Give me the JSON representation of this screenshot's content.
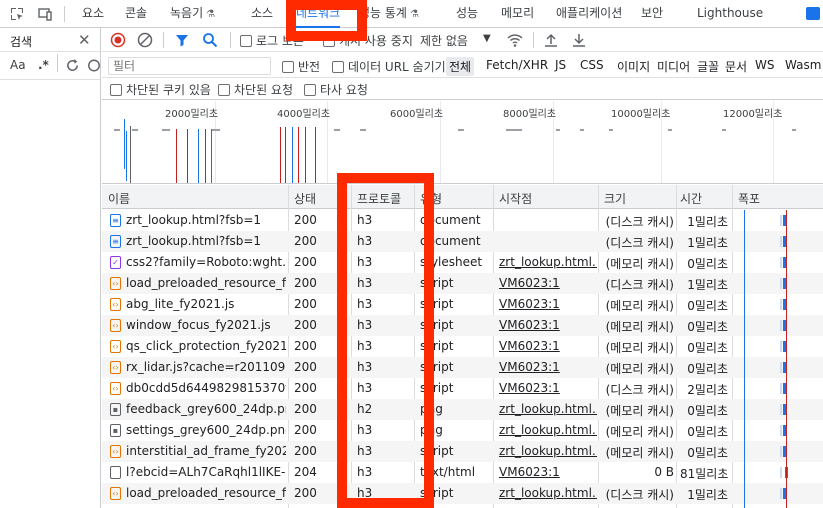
{
  "top_tabs": [
    {
      "label": "요소",
      "active": false,
      "flask": false
    },
    {
      "label": "콘솔",
      "active": false,
      "flask": false
    },
    {
      "label": "녹음기",
      "active": false,
      "flask": true
    },
    {
      "label": "소스",
      "active": false,
      "flask": false
    },
    {
      "label": "네트워크",
      "active": true,
      "flask": false
    },
    {
      "label": "성능 통계",
      "active": false,
      "flask": true
    },
    {
      "label": "성능",
      "active": false,
      "flask": false
    },
    {
      "label": "메모리",
      "active": false,
      "flask": false
    },
    {
      "label": "애플리케이션",
      "active": false,
      "flask": false
    },
    {
      "label": "보안",
      "active": false,
      "flask": false
    },
    {
      "label": "Lighthouse",
      "active": false,
      "flask": false
    }
  ],
  "sidebar": {
    "title": "검색",
    "close_icon": "close-icon",
    "match_case": "Aa",
    "regex": ".*"
  },
  "toolbar": {
    "preserve_log": "로그 보존",
    "disable_cache": "캐시 사용 중지",
    "throttle": "제한 없음"
  },
  "filter": {
    "placeholder": "필터",
    "invert": "반전",
    "hide_data_urls": "데이터 URL 숨기기",
    "types": [
      "전체",
      "Fetch/XHR",
      "JS",
      "CSS",
      "이미지",
      "미디어",
      "글꼴",
      "문서",
      "WS",
      "Wasm"
    ],
    "blocked_cookies": "차단된 쿠키 있음",
    "blocked_requests": "차단된 요청",
    "third_party": "타사 요청"
  },
  "overview": {
    "labels": [
      "2000밀리초",
      "4000밀리초",
      "6000밀리초",
      "8000밀리초",
      "10000밀리초",
      "12000밀리초"
    ]
  },
  "table": {
    "headers": [
      "이름",
      "상태",
      "프로토콜",
      "유형",
      "시작점",
      "크기",
      "시간",
      "폭포"
    ],
    "rows": [
      {
        "icon": "doc",
        "name": "zrt_lookup.html?fsb=1",
        "status": "200",
        "protocol": "h3",
        "type": "document",
        "initiator": "",
        "size": "(디스크 캐시)",
        "time": "1밀리초"
      },
      {
        "icon": "doc",
        "name": "zrt_lookup.html?fsb=1",
        "status": "200",
        "protocol": "h3",
        "type": "document",
        "initiator": "",
        "size": "(디스크 캐시)",
        "time": "1밀리초"
      },
      {
        "icon": "css",
        "name": "css2?family=Roboto:wght…",
        "status": "200",
        "protocol": "h3",
        "type": "stylesheet",
        "initiator": "zrt_lookup.html…",
        "size": "(메모리 캐시)",
        "time": "0밀리초"
      },
      {
        "icon": "script",
        "name": "load_preloaded_resource_f…",
        "status": "200",
        "protocol": "h3",
        "type": "script",
        "initiator": "VM6023:1",
        "size": "(디스크 캐시)",
        "time": "1밀리초"
      },
      {
        "icon": "script",
        "name": "abg_lite_fy2021.js",
        "status": "200",
        "protocol": "h3",
        "type": "script",
        "initiator": "VM6023:1",
        "size": "(메모리 캐시)",
        "time": "0밀리초"
      },
      {
        "icon": "script",
        "name": "window_focus_fy2021.js",
        "status": "200",
        "protocol": "h3",
        "type": "script",
        "initiator": "VM6023:1",
        "size": "(메모리 캐시)",
        "time": "0밀리초"
      },
      {
        "icon": "script",
        "name": "qs_click_protection_fy2021.js",
        "status": "200",
        "protocol": "h3",
        "type": "script",
        "initiator": "VM6023:1",
        "size": "(메모리 캐시)",
        "time": "0밀리초"
      },
      {
        "icon": "script",
        "name": "rx_lidar.js?cache=r20110914",
        "status": "200",
        "protocol": "h3",
        "type": "script",
        "initiator": "VM6023:1",
        "size": "(메모리 캐시)",
        "time": "0밀리초"
      },
      {
        "icon": "script",
        "name": "db0cdd5d6449829815370f…",
        "status": "200",
        "protocol": "h3",
        "type": "script",
        "initiator": "VM6023:1",
        "size": "(디스크 캐시)",
        "time": "2밀리초"
      },
      {
        "icon": "img",
        "name": "feedback_grey600_24dp.png",
        "status": "200",
        "protocol": "h2",
        "type": "png",
        "initiator": "zrt_lookup.html…",
        "size": "(메모리 캐시)",
        "time": "0밀리초"
      },
      {
        "icon": "img",
        "name": "settings_grey600_24dp.png",
        "status": "200",
        "protocol": "h3",
        "type": "png",
        "initiator": "zrt_lookup.html…",
        "size": "(메모리 캐시)",
        "time": "0밀리초"
      },
      {
        "icon": "script",
        "name": "interstitial_ad_frame_fy202…",
        "status": "200",
        "protocol": "h3",
        "type": "script",
        "initiator": "zrt_lookup.html…",
        "size": "(메모리 캐시)",
        "time": "0밀리초"
      },
      {
        "icon": "other",
        "name": "l?ebcid=ALh7CaRqhl1lIKE-…",
        "status": "204",
        "protocol": "h3",
        "type": "text/html",
        "initiator": "VM6023:1",
        "size": "0 B",
        "time": "81밀리초"
      },
      {
        "icon": "script",
        "name": "load_preloaded_resource_f…",
        "status": "200",
        "protocol": "h3",
        "type": "script",
        "initiator": "zrt_lookup.html…",
        "size": "(디스크 캐시)",
        "time": "1밀리초"
      }
    ]
  },
  "colors": {
    "accent": "#1a73e8",
    "record": "#d93025",
    "highlight": "#ff2a00"
  }
}
